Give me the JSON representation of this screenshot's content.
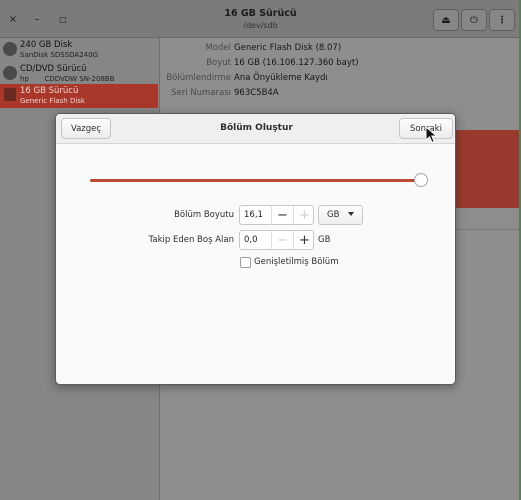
{
  "window": {
    "title": "16 GB Sürücü",
    "subtitle": "/dev/sdb",
    "close_glyph": "×",
    "minimize_glyph": "–",
    "maximize_glyph": "□",
    "eject_glyph": "⏏",
    "power_glyph": "⏻",
    "menu_glyph": "⋮"
  },
  "sidebar": {
    "drives": [
      {
        "name": "240 GB Disk",
        "sub": "SanDisk SDSSDA240G",
        "icon": "hard-disk-icon"
      },
      {
        "name": "CD/DVD Sürücü",
        "sub": "hp       CDDVDW SN-208BB",
        "icon": "optical-drive-icon"
      },
      {
        "name": "16 GB Sürücü",
        "sub": "Generic Flash Disk",
        "icon": "usb-drive-icon"
      }
    ]
  },
  "details": {
    "rows": [
      {
        "key": "Model",
        "value": "Generic Flash Disk (8.07)"
      },
      {
        "key": "Boyut",
        "value": "16 GB (16.106.127.360 bayt)"
      },
      {
        "key": "Bölümlendirme",
        "value": "Ana Önyükleme Kaydı"
      },
      {
        "key": "Seri Numarası",
        "value": "963C5B4A"
      }
    ]
  },
  "dialog": {
    "title": "Bölüm Oluştur",
    "cancel_label": "Vazgeç",
    "next_label": "Sonraki",
    "slider_fraction": 1.0,
    "partition_size_label": "Bölüm Boyutu",
    "partition_size_value": "16,1",
    "size_unit": "GB",
    "free_space_label": "Takip Eden Boş Alan",
    "free_space_value": "0,0",
    "free_space_unit": "GB",
    "minus_glyph": "−",
    "plus_glyph": "+",
    "extended_label": "Genişletilmiş Bölüm",
    "extended_checked": false
  },
  "colors": {
    "accent": "#bd4a35",
    "selection": "#a9382a"
  }
}
